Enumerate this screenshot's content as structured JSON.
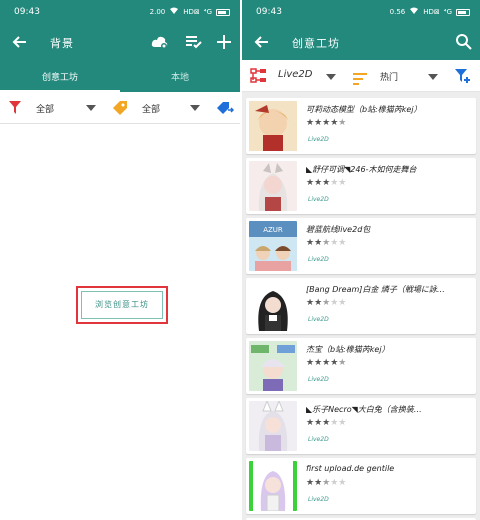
{
  "left": {
    "status": {
      "time": "09:43",
      "net_speed": "2.00",
      "signal": "HD⊠",
      "signal2": "⁴G",
      "battery": ""
    },
    "title": "背景",
    "tabs": [
      {
        "label": "创意工坊",
        "active": true
      },
      {
        "label": "本地",
        "active": false
      }
    ],
    "filters": [
      {
        "label": "全部"
      },
      {
        "label": "全部"
      }
    ],
    "browse_button": "浏览创意工坊"
  },
  "right": {
    "status": {
      "time": "09:43",
      "net_speed": "0.56",
      "signal": "HD⊠",
      "signal2": "⁴G"
    },
    "title": "创意工坊",
    "category": "Live2D",
    "sort": "热门",
    "items": [
      {
        "title": "可莉动态模型（b站:橡猫芮kej）",
        "rating": 4.5,
        "tag": "Live2D",
        "thumb": "item1"
      },
      {
        "title": "◣舒仔可调◥246-木如何走舞台",
        "rating": 3,
        "tag": "Live2D",
        "thumb": "item2"
      },
      {
        "title": "碧蓝航线live2d包",
        "rating": 2.5,
        "tag": "Live2D",
        "thumb": "item3"
      },
      {
        "title": "[Bang Dream]白金 燐子（戦場に詠…",
        "rating": 2.5,
        "tag": "Live2D",
        "thumb": "item4"
      },
      {
        "title": "杰宝（b站:橡猫芮kej）",
        "rating": 4.5,
        "tag": "Live2D",
        "thumb": "item5"
      },
      {
        "title": "◣乐子Necro◥大白兔（含换装…",
        "rating": 3,
        "tag": "Live2D",
        "thumb": "item6"
      },
      {
        "title": "first upload.de gentile",
        "rating": 2.5,
        "tag": "Live2D",
        "thumb": "item7"
      }
    ]
  },
  "colors": {
    "primary": "#22897c",
    "accent_red": "#e0363b",
    "icon_blue": "#1e6fd9",
    "icon_orange": "#f2a623"
  }
}
